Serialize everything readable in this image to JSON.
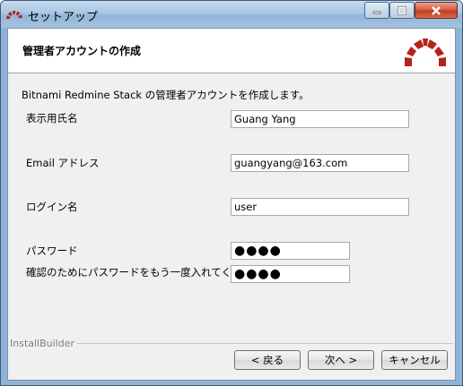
{
  "window": {
    "title": "セットアップ"
  },
  "header": {
    "title": "管理者アカウントの作成"
  },
  "intro": "Bitnami Redmine Stack の管理者アカウントを作成します。",
  "fields": {
    "display_name": {
      "label": "表示用氏名",
      "value": "Guang Yang"
    },
    "email": {
      "label": "Email アドレス",
      "value": "guangyang@163.com"
    },
    "login": {
      "label": "ログイン名",
      "value": "user"
    },
    "password": {
      "label": "パスワード",
      "value": "●●●●"
    },
    "password_confirm": {
      "label": "確認のためにパスワードをもう一度入れてください",
      "value": "●●●●"
    }
  },
  "footer": {
    "brand": "InstallBuilder"
  },
  "buttons": {
    "back": "< 戻る",
    "next": "次へ >",
    "cancel": "キャンセル"
  },
  "colors": {
    "brand_red": "#b5221c",
    "titlebar": "#a9c6e3"
  }
}
